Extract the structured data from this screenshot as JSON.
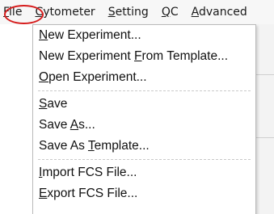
{
  "menubar": {
    "items": [
      {
        "mnemonic": "F",
        "rest": "ile"
      },
      {
        "mnemonic": "C",
        "rest": "ytometer"
      },
      {
        "mnemonic": "S",
        "rest": "etting"
      },
      {
        "mnemonic": "Q",
        "rest": "C"
      },
      {
        "mnemonic": "A",
        "rest": "dvanced"
      }
    ]
  },
  "file_menu": {
    "groups": [
      [
        {
          "pre": "",
          "mnemonic": "N",
          "post": "ew Experiment..."
        },
        {
          "pre": "New Experiment ",
          "mnemonic": "F",
          "post": "rom Template..."
        },
        {
          "pre": "",
          "mnemonic": "O",
          "post": "pen Experiment..."
        }
      ],
      [
        {
          "pre": "",
          "mnemonic": "S",
          "post": "ave"
        },
        {
          "pre": "Save ",
          "mnemonic": "A",
          "post": "s..."
        },
        {
          "pre": "Save As ",
          "mnemonic": "T",
          "post": "emplate..."
        }
      ],
      [
        {
          "pre": "",
          "mnemonic": "I",
          "post": "mport FCS File..."
        },
        {
          "pre": "",
          "mnemonic": "E",
          "post": "xport FCS File..."
        }
      ]
    ]
  },
  "colors": {
    "highlight_ring": "#d61c1c",
    "menubar_bg": "#f7f7f7",
    "dropdown_border": "#b9b9b9"
  }
}
